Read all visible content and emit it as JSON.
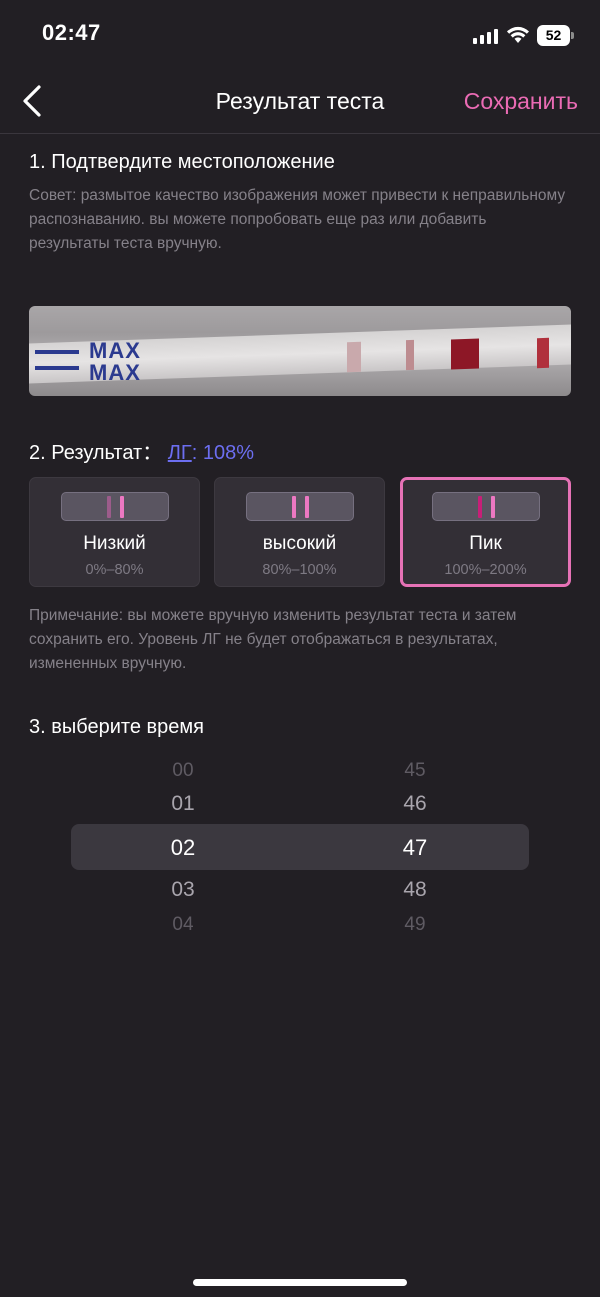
{
  "status_bar": {
    "time": "02:47",
    "battery": "52"
  },
  "nav": {
    "title": "Результат теста",
    "save_label": "Сохранить"
  },
  "section1": {
    "title": "1. Подтвердите местоположение",
    "hint": "Совет: размытое качество изображения может привести к неправильному распознаванию. вы можете попробовать еще раз или добавить результаты теста вручную.",
    "strip_text_1": "MAX",
    "strip_text_2": "MAX"
  },
  "section2": {
    "title": "2. Результат：",
    "lh_label": "ЛГ",
    "lh_value": ": 108%",
    "options": [
      {
        "name": "Низкий",
        "range": "0%–80%",
        "selected": false
      },
      {
        "name": "высокий",
        "range": "80%–100%",
        "selected": false
      },
      {
        "name": "Пик",
        "range": "100%–200%",
        "selected": true
      }
    ],
    "note": "Примечание: вы можете вручную изменить результат теста и затем сохранить его. Уровень ЛГ не будет отображаться в результатах, измененных вручную."
  },
  "section3": {
    "title": "3. выберите время",
    "hours": [
      "00",
      "01",
      "02",
      "03",
      "04"
    ],
    "minutes": [
      "45",
      "46",
      "47",
      "48",
      "49"
    ],
    "selected_hour": "02",
    "selected_minute": "47"
  },
  "colors": {
    "accent": "#ea6bb4",
    "link": "#6c6ef0",
    "background": "#221f24"
  }
}
